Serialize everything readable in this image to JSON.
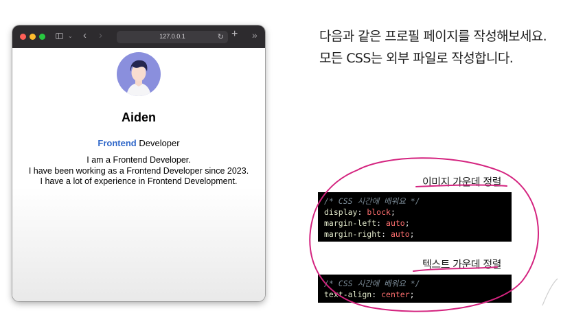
{
  "browser": {
    "url": "127.0.0.1",
    "icons": [
      "sidebar-icon",
      "chevron-down-icon",
      "back-icon",
      "forward-icon",
      "reload-icon",
      "new-tab-icon",
      "more-icon"
    ]
  },
  "profile": {
    "name": "Aiden",
    "role_highlight": "Frontend",
    "role_rest": "Developer",
    "bio": [
      "I am a Frontend Developer.",
      "I have been working as a Frontend Developer since 2023.",
      "I have a lot of experience in Frontend Development."
    ]
  },
  "instructions": {
    "line1": "다음과 같은 프로필 페이지를 작성해보세요.",
    "line2": "모든 CSS는 외부 파일로 작성합니다."
  },
  "tips": [
    {
      "title": "이미지 가운데 정렬",
      "comment": "/* CSS 시간에 배워요 */",
      "lines": [
        {
          "prop": "display",
          "value": "block"
        },
        {
          "prop": "margin-left",
          "value": "auto"
        },
        {
          "prop": "margin-right",
          "value": "auto"
        }
      ]
    },
    {
      "title": "텍스트 가운데 정렬",
      "comment": "/* CSS 시간에 배워요 */",
      "lines": [
        {
          "prop": "text-align",
          "value": "center"
        }
      ]
    }
  ],
  "colors": {
    "titlebar": "#2d2b2e",
    "accent_link": "#2f67c9",
    "avatar_bg": "#8a8fdd",
    "annotation": "#d4237f"
  }
}
